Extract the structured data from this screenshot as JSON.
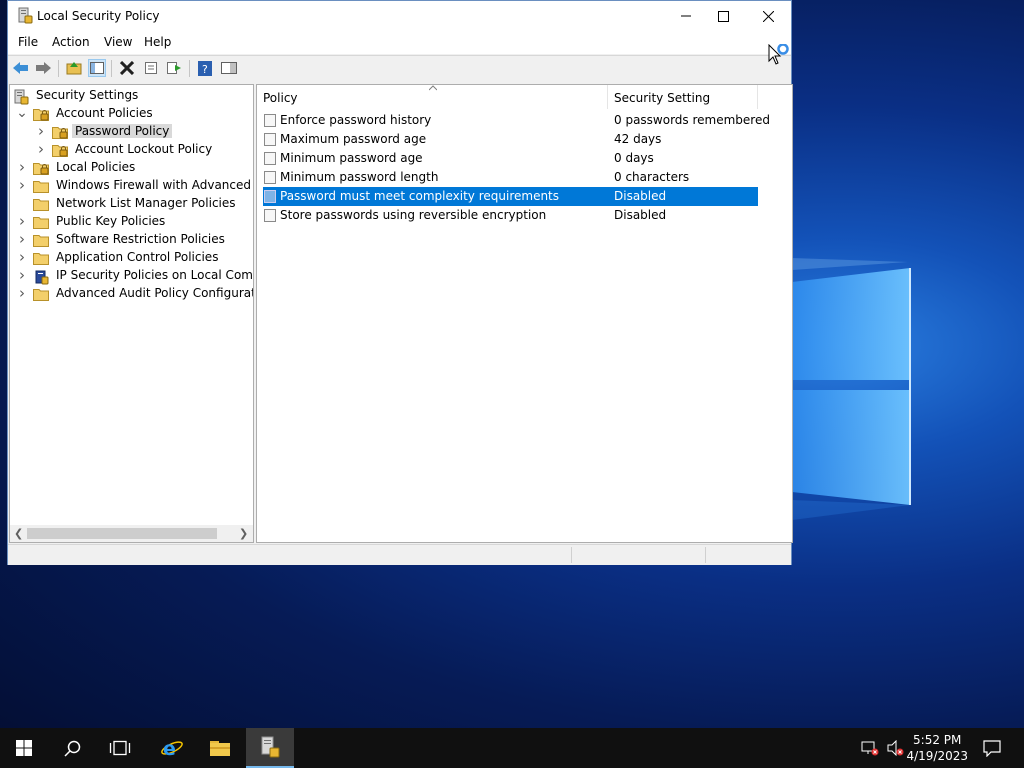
{
  "window": {
    "title": "Local Security Policy",
    "minimize_icon": "minimize-icon",
    "maximize_icon": "maximize-icon",
    "close_icon": "close-icon"
  },
  "menu": [
    "File",
    "Action",
    "View",
    "Help"
  ],
  "toolbar": [
    "back-arrow-icon",
    "forward-arrow-icon",
    "up-folder-icon",
    "show-hide-tree-icon",
    "delete-icon",
    "properties-icon",
    "export-list-icon",
    "help-icon",
    "show-action-pane-icon"
  ],
  "tree": [
    {
      "label": "Security Settings",
      "level": 0,
      "expander": "",
      "icon": "security-settings-icon"
    },
    {
      "label": "Account Policies",
      "level": 1,
      "expander": "open",
      "icon": "folder-lock-icon"
    },
    {
      "label": "Password Policy",
      "level": 2,
      "expander": "closed",
      "icon": "folder-lock-icon",
      "selected": true
    },
    {
      "label": "Account Lockout Policy",
      "level": 2,
      "expander": "closed",
      "icon": "folder-lock-icon"
    },
    {
      "label": "Local Policies",
      "level": 1,
      "expander": "closed",
      "icon": "folder-lock-icon"
    },
    {
      "label": "Windows Firewall with Advanced Secu",
      "level": 1,
      "expander": "closed",
      "icon": "folder-icon"
    },
    {
      "label": "Network List Manager Policies",
      "level": 1,
      "expander": "",
      "icon": "folder-icon"
    },
    {
      "label": "Public Key Policies",
      "level": 1,
      "expander": "closed",
      "icon": "folder-icon"
    },
    {
      "label": "Software Restriction Policies",
      "level": 1,
      "expander": "closed",
      "icon": "folder-icon"
    },
    {
      "label": "Application Control Policies",
      "level": 1,
      "expander": "closed",
      "icon": "folder-icon"
    },
    {
      "label": "IP Security Policies on Local Compute",
      "level": 1,
      "expander": "closed",
      "icon": "ip-security-icon"
    },
    {
      "label": "Advanced Audit Policy Configuration",
      "level": 1,
      "expander": "closed",
      "icon": "folder-icon"
    }
  ],
  "list": {
    "columns": [
      "Policy",
      "Security Setting"
    ],
    "rows": [
      {
        "policy": "Enforce password history",
        "setting": "0 passwords remembered"
      },
      {
        "policy": "Maximum password age",
        "setting": "42 days"
      },
      {
        "policy": "Minimum password age",
        "setting": "0 days"
      },
      {
        "policy": "Minimum password length",
        "setting": "0 characters"
      },
      {
        "policy": "Password must meet complexity requirements",
        "setting": "Disabled",
        "selected": true
      },
      {
        "policy": "Store passwords using reversible encryption",
        "setting": "Disabled"
      }
    ]
  },
  "taskbar": {
    "buttons": [
      "start-icon",
      "search-icon",
      "task-view-icon",
      "internet-explorer-icon",
      "file-explorer-icon",
      "local-security-policy-icon"
    ],
    "time": "5:52 PM",
    "date": "4/19/2023",
    "tray": [
      "network-icon",
      "volume-icon",
      "notifications-icon"
    ]
  },
  "colors": {
    "selection": "#0078d7",
    "desktop": "#0a2f85"
  }
}
